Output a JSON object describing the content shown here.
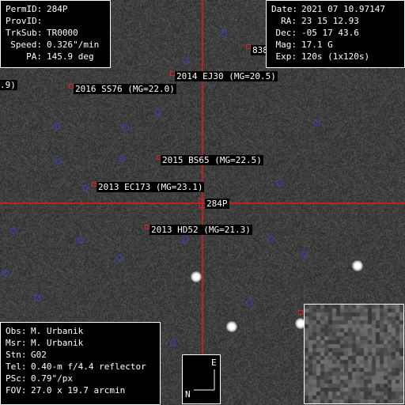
{
  "target_info": {
    "rows": [
      {
        "key": "PermID:",
        "value": "284P"
      },
      {
        "key": "ProvID:",
        "value": ""
      },
      {
        "key": "TrkSub:",
        "value": "TR0000"
      },
      {
        "key": "Speed:",
        "value": "0.326\"/min"
      },
      {
        "key": "PA:",
        "value": "145.9 deg"
      }
    ]
  },
  "observation_info": {
    "rows": [
      {
        "key": "Date:",
        "value": "2021 07 10.97147"
      },
      {
        "key": "RA:",
        "value": "23 15 12.93"
      },
      {
        "key": "Dec:",
        "value": "-05 17 43.6"
      },
      {
        "key": "Mag:",
        "value": "17.1 G"
      },
      {
        "key": "Exp:",
        "value": "120s (1x120s)"
      }
    ]
  },
  "observer_info": {
    "rows": [
      {
        "key": "Obs:",
        "value": "M. Urbanik"
      },
      {
        "key": "Msr:",
        "value": "M. Urbanik"
      },
      {
        "key": "Stn:",
        "value": "G02"
      },
      {
        "key": "Tel:",
        "value": "0.40-m f/4.4 reflector"
      },
      {
        "key": "PSc:",
        "value": "0.79\"/px"
      },
      {
        "key": "FOV:",
        "value": "27.0 x 19.7 arcmin"
      }
    ]
  },
  "asteroid_labels": {
    "a2014ej30": "2014 EJ30 (MG=20.5)",
    "a2016ss76": "2016 SS76 (MG=22.0)",
    "a2015bs65": "2015 BS65 (MG=22.5)",
    "a2013ec173": "2013 EC173 (MG=23.1)",
    "a2013hd52": "2013 HD52 (MG=21.3)",
    "target": "284P",
    "partial_left": ".9)",
    "partial_top_right": "838"
  },
  "compass": {
    "east": "E",
    "north": "N"
  },
  "colors": {
    "crosshair": "#c81e1e",
    "marker": "#e02020",
    "star_circle": "#3b3bd6",
    "panel_bg": "#000000",
    "panel_border": "#ffffff"
  }
}
